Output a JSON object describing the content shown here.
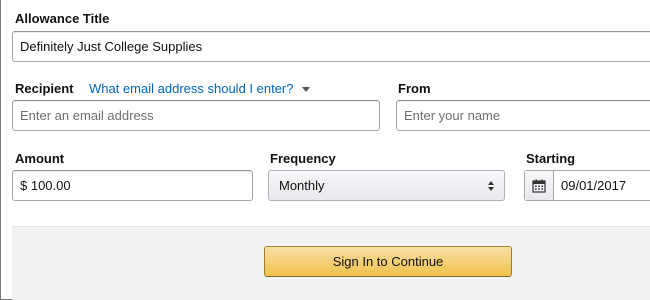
{
  "allowance": {
    "label": "Allowance Title",
    "value": "Definitely Just College Supplies"
  },
  "recipient": {
    "label": "Recipient",
    "help_link": "What email address should I enter?",
    "placeholder": "Enter an email address"
  },
  "from": {
    "label": "From",
    "placeholder": "Enter your name"
  },
  "amount": {
    "label": "Amount",
    "value": "$ 100.00"
  },
  "frequency": {
    "label": "Frequency",
    "selected": "Monthly"
  },
  "starting": {
    "label": "Starting",
    "value": "09/01/2017",
    "icon": "calendar-icon"
  },
  "footer": {
    "button_label": "Sign In to Continue"
  },
  "colors": {
    "link": "#0066c0",
    "button_top": "#f7dfa5",
    "button_bottom": "#f0c14b",
    "footer_bg": "#f3f3f3"
  }
}
